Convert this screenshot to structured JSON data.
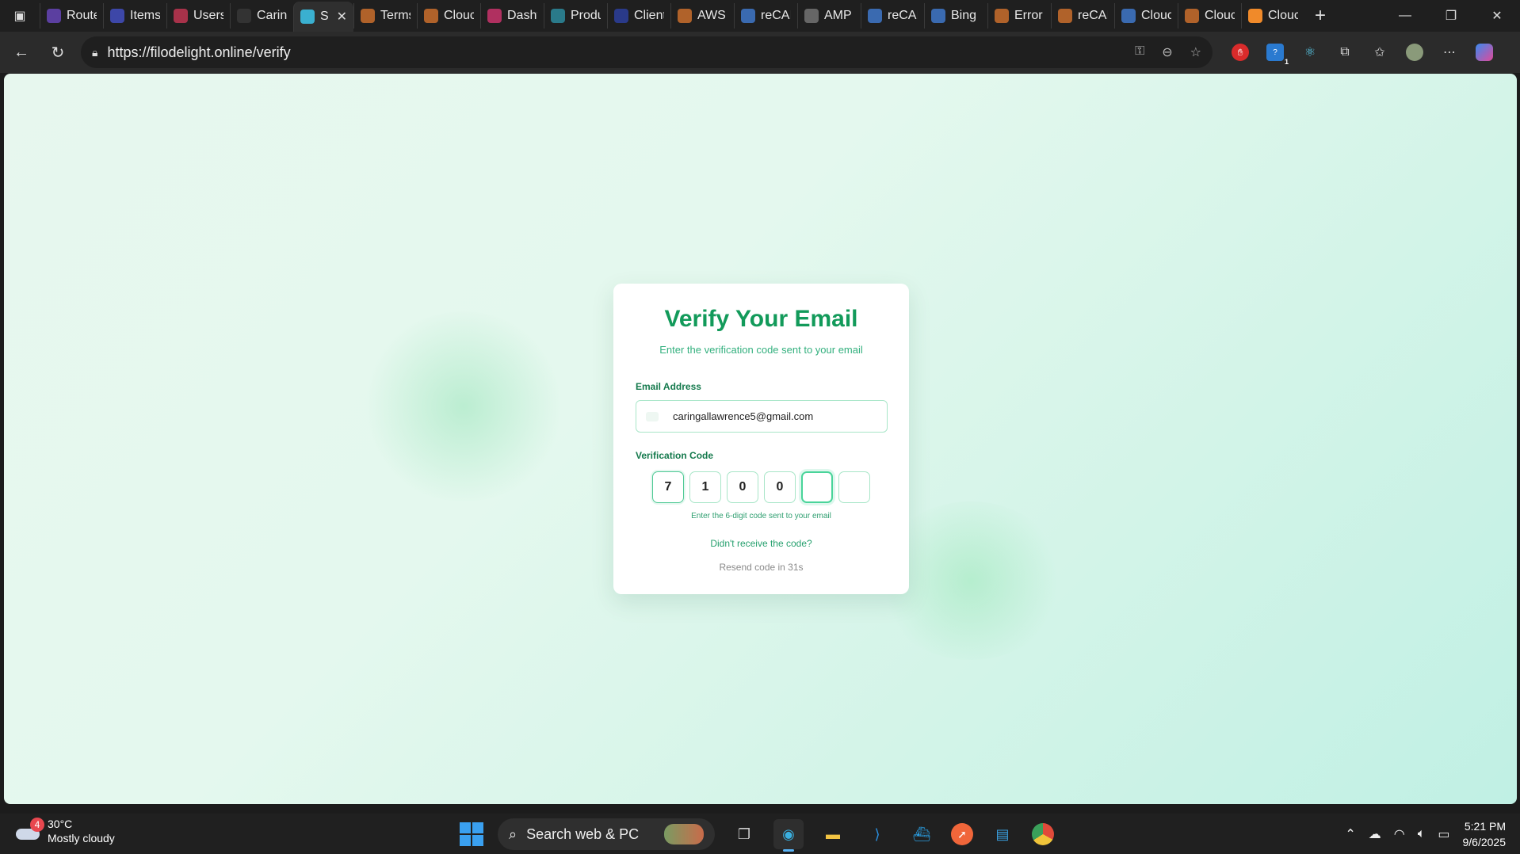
{
  "browser": {
    "tabs": [
      {
        "title": "Route",
        "color": "#5b3fa0",
        "icon": "page-icon"
      },
      {
        "title": "Items",
        "color": "#3d47a8",
        "icon": "page-icon"
      },
      {
        "title": "Users",
        "color": "#a8324a",
        "icon": "page-icon"
      },
      {
        "title": "Carin",
        "color": "#333333",
        "icon": "github-icon"
      },
      {
        "title": "S",
        "color": "#3ab0d0",
        "icon": "react-icon",
        "active": true
      },
      {
        "title": "Terms",
        "color": "#b0622a",
        "icon": "cloud-icon"
      },
      {
        "title": "Clouc",
        "color": "#b0622a",
        "icon": "cloud-icon"
      },
      {
        "title": "Dasht",
        "color": "#b03060",
        "icon": "dashboard-icon"
      },
      {
        "title": "Produ",
        "color": "#2a7a8a",
        "icon": "leaf-icon"
      },
      {
        "title": "Client",
        "color": "#2a3a8a",
        "icon": "shield-icon"
      },
      {
        "title": "AWS",
        "color": "#b0622a",
        "icon": "sparkle-icon"
      },
      {
        "title": "reCAI",
        "color": "#3a6ab0",
        "icon": "recaptcha-icon"
      },
      {
        "title": "AMP",
        "color": "#666666",
        "icon": "openai-icon"
      },
      {
        "title": "reCAI",
        "color": "#3a6ab0",
        "icon": "search-icon"
      },
      {
        "title": "Bing",
        "color": "#3a6ab0",
        "icon": "search-icon"
      },
      {
        "title": "Error",
        "color": "#b0622a",
        "icon": "stack-icon"
      },
      {
        "title": "reCAI",
        "color": "#b0622a",
        "icon": "sparkle-icon"
      },
      {
        "title": "Clouc",
        "color": "#3a6ab0",
        "icon": "search-icon"
      },
      {
        "title": "Clouc",
        "color": "#b0622a",
        "icon": "cloud-icon"
      },
      {
        "title": "Clouc",
        "color": "#f08a2a",
        "icon": "cloud-icon"
      }
    ],
    "url": "https://filodelight.online/verify",
    "extension_badge": "1"
  },
  "page": {
    "title": "Verify Your Email",
    "subtitle": "Enter the verification code sent to your email",
    "email_label": "Email Address",
    "email_value": "caringallawrence5@gmail.com",
    "code_label": "Verification Code",
    "code_digits": [
      "7",
      "1",
      "0",
      "0",
      "",
      ""
    ],
    "hint": "Enter the 6-digit code sent to your email",
    "resend_question": "Didn't receive the code?",
    "resend_timer": "Resend code in 31s",
    "colors": {
      "title": "#129a5a",
      "accent": "#33b07e",
      "background": "#e4f8ee"
    }
  },
  "taskbar": {
    "weather_temp": "30°C",
    "weather_desc": "Mostly cloudy",
    "weather_badge": "4",
    "search_placeholder": "Search web & PC",
    "time": "5:21 PM",
    "date": "9/6/2025"
  }
}
